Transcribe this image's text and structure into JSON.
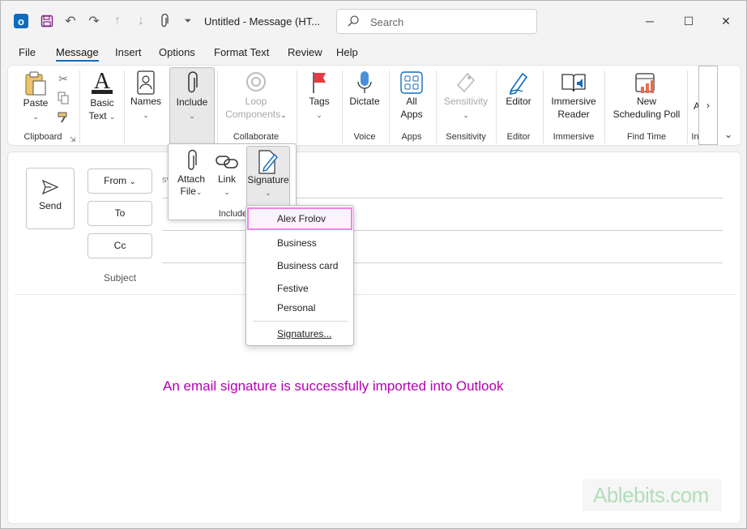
{
  "window": {
    "title": "Untitled  -  Message (HT...",
    "search_placeholder": "Search"
  },
  "menu": {
    "tabs": [
      {
        "label": "File"
      },
      {
        "label": "Message",
        "active": true
      },
      {
        "label": "Insert"
      },
      {
        "label": "Options"
      },
      {
        "label": "Format Text"
      },
      {
        "label": "Review"
      },
      {
        "label": "Help"
      }
    ]
  },
  "ribbon": {
    "clipboard": {
      "paste": "Paste",
      "group": "Clipboard"
    },
    "basic_text": {
      "line1": "Basic",
      "line2": "Text"
    },
    "names": {
      "label": "Names"
    },
    "include": {
      "label": "Include"
    },
    "collaborate": {
      "line1": "Loop",
      "line2": "Components",
      "group": "Collaborate"
    },
    "tags": {
      "label": "Tags"
    },
    "voice": {
      "label": "Dictate",
      "group": "Voice"
    },
    "apps": {
      "line1": "All",
      "line2": "Apps",
      "group": "Apps"
    },
    "sensitivity": {
      "label": "Sensitivity",
      "group": "Sensitivity"
    },
    "editor": {
      "label": "Editor",
      "group": "Editor"
    },
    "immersive": {
      "line1": "Immersive",
      "line2": "Reader",
      "group": "Immersive"
    },
    "find_time": {
      "line1": "New",
      "line2": "Scheduling Poll",
      "group": "Find Time"
    },
    "cut_group": "In"
  },
  "include_flyout": {
    "attach_line1": "Attach",
    "attach_line2": "File",
    "link": "Link",
    "signature": "Signature",
    "group": "Include"
  },
  "signature_menu": {
    "items": [
      {
        "label": "Alex Frolov",
        "highlighted": true
      },
      {
        "label": "Business"
      },
      {
        "label": "Business card"
      },
      {
        "label": "Festive"
      },
      {
        "label": "Personal"
      }
    ],
    "manage": "Signatures..."
  },
  "compose": {
    "send": "Send",
    "from": "From",
    "to": "To",
    "cc": "Cc",
    "subject": "Subject",
    "from_hint": "sv"
  },
  "caption": "An email signature is successfully imported into Outlook",
  "watermark": "Ablebits.com",
  "colors": {
    "accent": "#0f6cbd",
    "caption": "#b400b4",
    "highlight_border": "#ee82ee"
  }
}
